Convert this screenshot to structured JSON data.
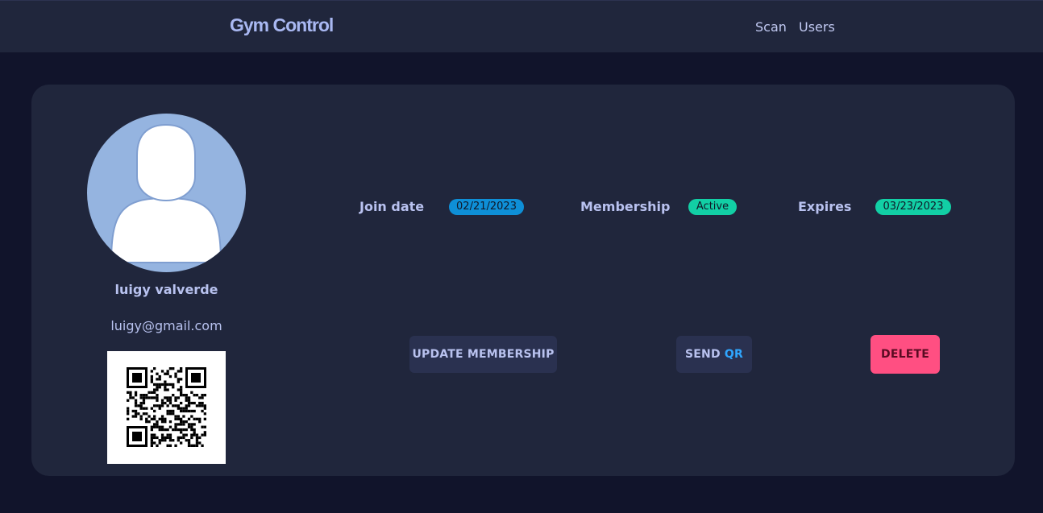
{
  "navbar": {
    "brand": "Gym Control",
    "links": [
      {
        "label": "Scan"
      },
      {
        "label": "Users"
      }
    ]
  },
  "profile": {
    "name": "luigy valverde",
    "email": "luigy@gmail.com"
  },
  "info": {
    "join_date_label": "Join date",
    "join_date_value": "02/21/2023",
    "membership_label": "Membership",
    "membership_value": "Active",
    "expires_label": "Expires",
    "expires_value": "03/23/2023"
  },
  "actions": {
    "update_label": "UPDATE MEMBERSHIP",
    "send_label": "SEND",
    "send_accent": "QR",
    "delete_label": "DELETE"
  },
  "colors": {
    "background": "#11142b",
    "card": "#20263c",
    "join_badge": "#0e8fd7",
    "status_badge": "#12cfa5",
    "delete_button": "#ff4f82",
    "qr_accent": "#2fa6ff"
  }
}
